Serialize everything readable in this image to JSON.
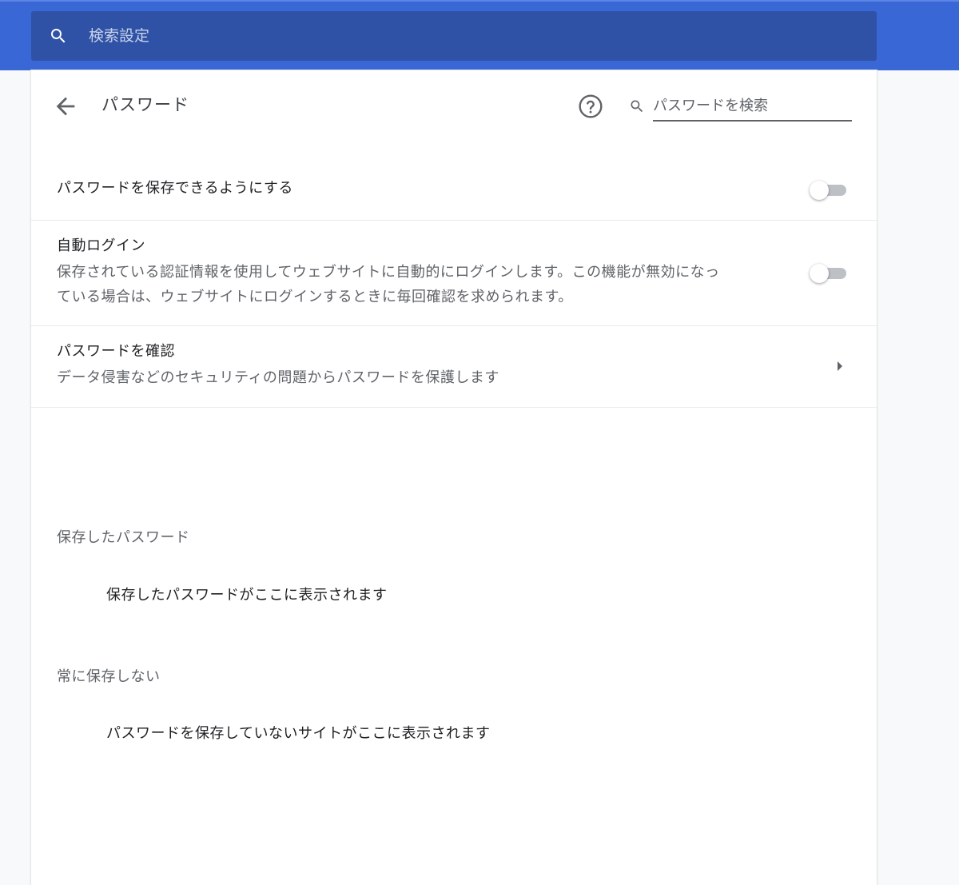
{
  "top_search": {
    "placeholder": "検索設定"
  },
  "header": {
    "title": "パスワード",
    "search_placeholder": "パスワードを検索"
  },
  "settings": {
    "offer_to_save": {
      "label": "パスワードを保存できるようにする",
      "enabled": false
    },
    "auto_signin": {
      "label": "自動ログイン",
      "description_line1": "保存されている認証情報を使用してウェブサイトに自動的にログインします。この機能が無効になっ",
      "description_line2": "ている場合は、ウェブサイトにログインするときに毎回確認を求められます。",
      "enabled": false
    },
    "check_passwords": {
      "label": "パスワードを確認",
      "description": "データ侵害などのセキュリティの問題からパスワードを保護します"
    }
  },
  "saved_passwords": {
    "heading": "保存したパスワード",
    "empty_message": "保存したパスワードがここに表示されます"
  },
  "never_saved": {
    "heading": "常に保存しない",
    "empty_message": "パスワードを保存していないサイトがここに表示されます"
  },
  "colors": {
    "topbar": "#3a67d6",
    "topsearch_bg": "#2f52a6",
    "toggle_off_track": "#bdc1c6",
    "text_primary": "#202124",
    "text_secondary": "#5f6368"
  }
}
